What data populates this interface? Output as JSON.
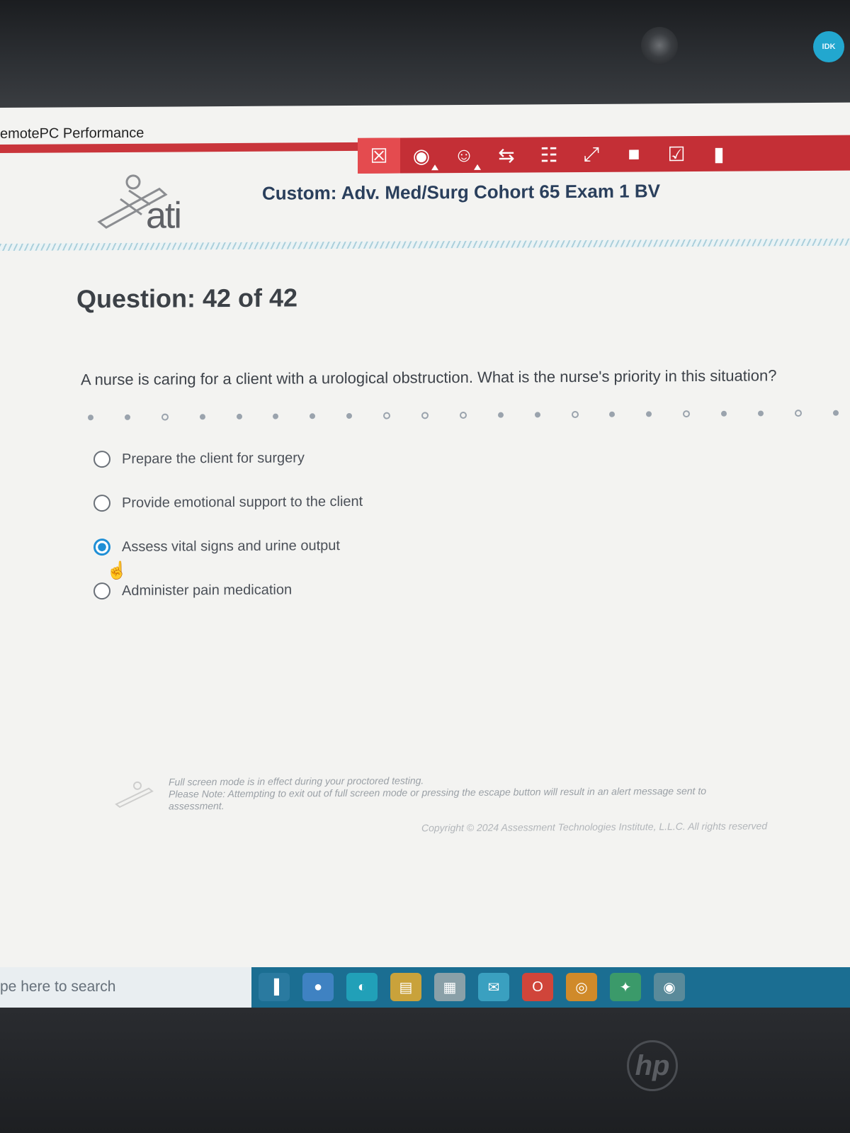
{
  "window": {
    "title": "emotePC Performance"
  },
  "top_badge": {
    "label": "IDK"
  },
  "toolbar": {
    "buttons": [
      {
        "name": "exit-fullscreen",
        "glyph": "☒"
      },
      {
        "name": "view",
        "glyph": "◉"
      },
      {
        "name": "accessibility",
        "glyph": "☺"
      },
      {
        "name": "swap",
        "glyph": "⇆"
      },
      {
        "name": "answer-choices",
        "glyph": "☷"
      },
      {
        "name": "fullscreen",
        "glyph": "⤢"
      },
      {
        "name": "comment",
        "glyph": "■"
      },
      {
        "name": "review",
        "glyph": "☑"
      },
      {
        "name": "flag",
        "glyph": "▮"
      }
    ],
    "accent": "#c42f36"
  },
  "header": {
    "logo_text": "ati",
    "exam_title": "Custom: Adv. Med/Surg Cohort 65 Exam 1 BV"
  },
  "question": {
    "heading": "Question: 42 of 42",
    "text": "A nurse is caring for a client with a urological obstruction. What is the nurse's priority in this situation?",
    "options": [
      {
        "label": "Prepare the client for surgery",
        "selected": false
      },
      {
        "label": "Provide emotional support to the client",
        "selected": false
      },
      {
        "label": "Assess vital signs and urine output",
        "selected": true
      },
      {
        "label": "Administer pain medication",
        "selected": false
      }
    ]
  },
  "footer": {
    "note_line1": "Full screen mode is in effect during your proctored testing.",
    "note_line2": "Please Note: Attempting to exit out of full screen mode or pressing the escape button will result in an alert message sent to",
    "note_line3": "assessment.",
    "copyright": "Copyright © 2024 Assessment Technologies Institute, L.L.C. All rights reserved"
  },
  "taskbar": {
    "search_placeholder": "pe here to search",
    "icons": [
      {
        "name": "task-view",
        "glyph": "▐",
        "color": "#2a7aa0"
      },
      {
        "name": "firefox",
        "glyph": "●",
        "color": "#3f82c2"
      },
      {
        "name": "edge",
        "glyph": "◐",
        "color": "#21a0b8"
      },
      {
        "name": "file-explorer",
        "glyph": "▤",
        "color": "#c9a23b"
      },
      {
        "name": "store",
        "glyph": "▦",
        "color": "#8aa0a8"
      },
      {
        "name": "mail",
        "glyph": "✉",
        "color": "#3aa0c0"
      },
      {
        "name": "office",
        "glyph": "O",
        "color": "#d0453a"
      },
      {
        "name": "chrome",
        "glyph": "◎",
        "color": "#d08a2a"
      },
      {
        "name": "app-green",
        "glyph": "✦",
        "color": "#3b9a6a"
      },
      {
        "name": "app-remote",
        "glyph": "◉",
        "color": "#5a8a9a"
      }
    ]
  },
  "brand": {
    "hp_label": "hp"
  }
}
